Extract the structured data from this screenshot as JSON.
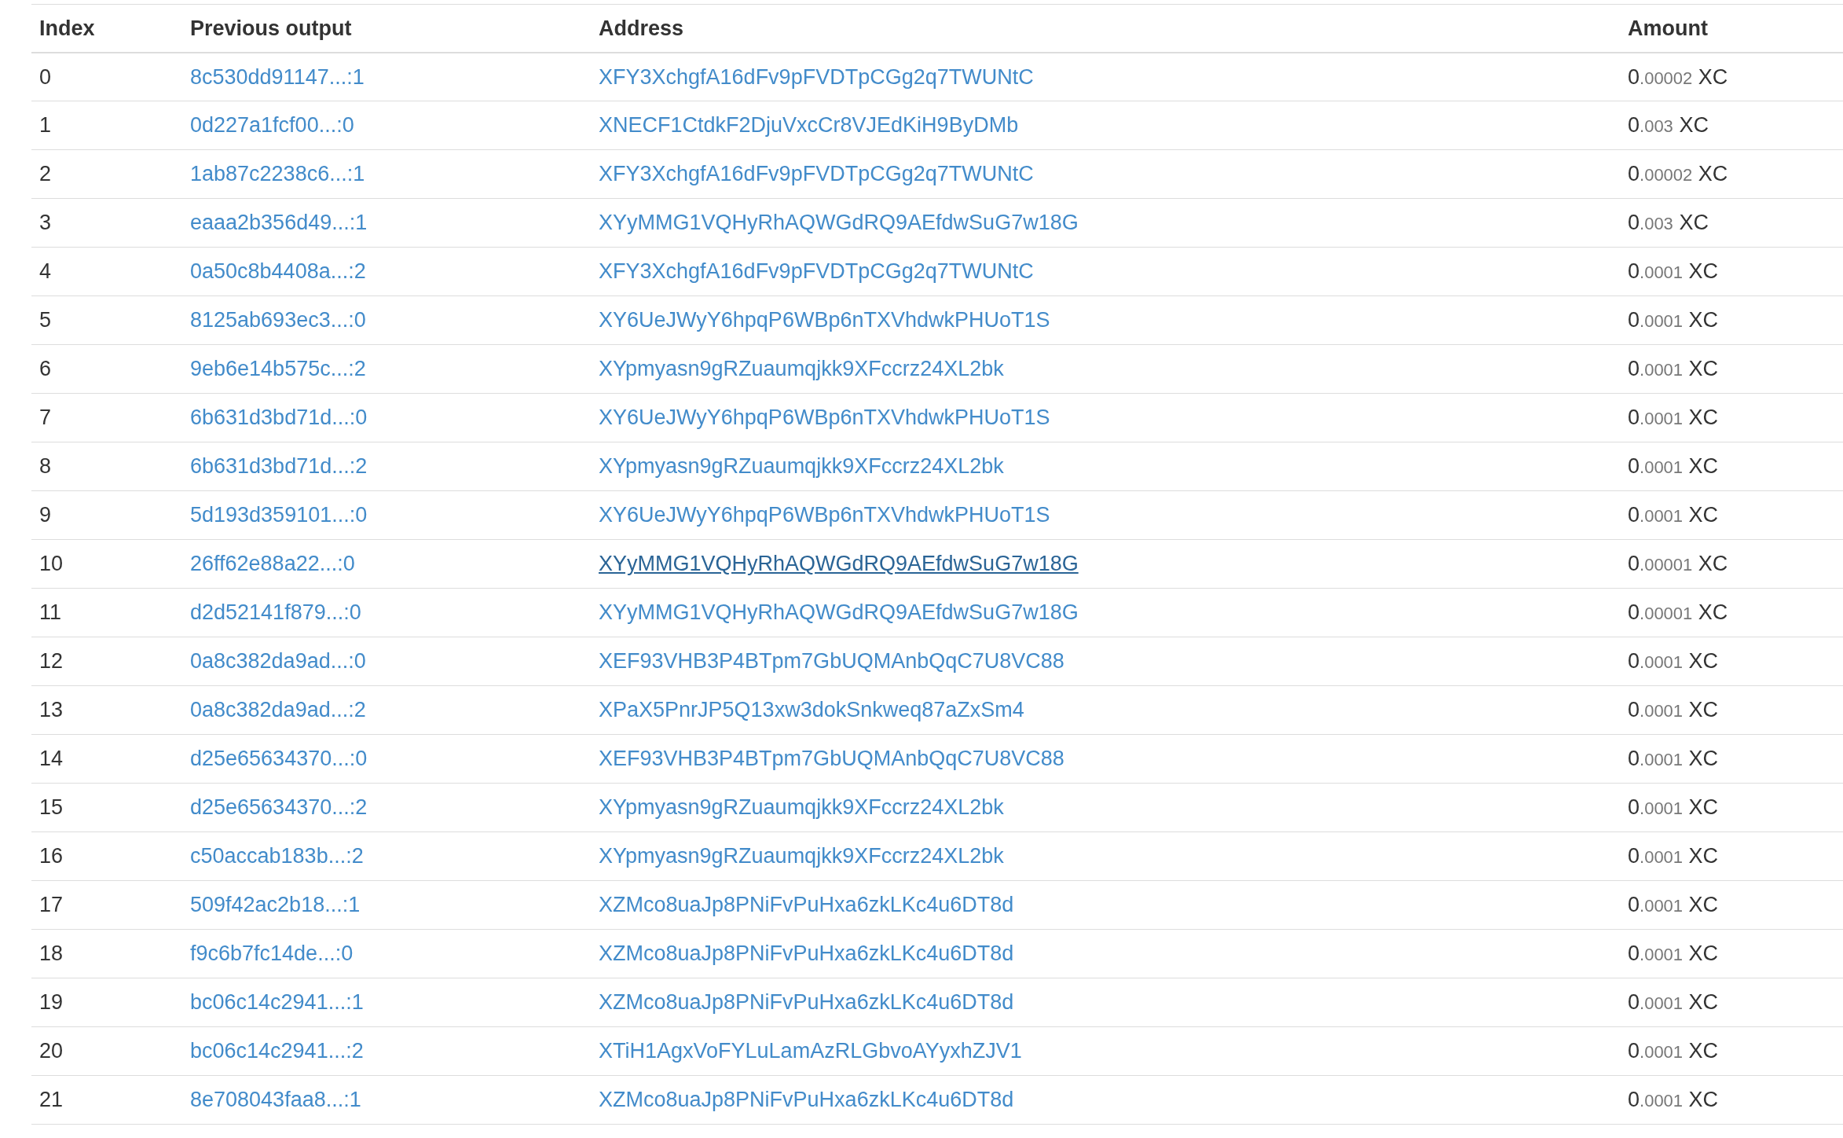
{
  "table": {
    "columns": [
      "Index",
      "Previous output",
      "Address",
      "Amount"
    ],
    "rows": [
      {
        "index": "0",
        "previous_output": "8c530dd91147...:1",
        "address": "XFY3XchgfA16dFv9pFVDTpCGg2q7TWUNtC",
        "address_hovered": false,
        "amount_whole": "0",
        "amount_fraction": ".00002",
        "unit": "XC"
      },
      {
        "index": "1",
        "previous_output": "0d227a1fcf00...:0",
        "address": "XNECF1CtdkF2DjuVxcCr8VJEdKiH9ByDMb",
        "address_hovered": false,
        "amount_whole": "0",
        "amount_fraction": ".003",
        "unit": "XC"
      },
      {
        "index": "2",
        "previous_output": "1ab87c2238c6...:1",
        "address": "XFY3XchgfA16dFv9pFVDTpCGg2q7TWUNtC",
        "address_hovered": false,
        "amount_whole": "0",
        "amount_fraction": ".00002",
        "unit": "XC"
      },
      {
        "index": "3",
        "previous_output": "eaaa2b356d49...:1",
        "address": "XYyMMG1VQHyRhAQWGdRQ9AEfdwSuG7w18G",
        "address_hovered": false,
        "amount_whole": "0",
        "amount_fraction": ".003",
        "unit": "XC"
      },
      {
        "index": "4",
        "previous_output": "0a50c8b4408a...:2",
        "address": "XFY3XchgfA16dFv9pFVDTpCGg2q7TWUNtC",
        "address_hovered": false,
        "amount_whole": "0",
        "amount_fraction": ".0001",
        "unit": "XC"
      },
      {
        "index": "5",
        "previous_output": "8125ab693ec3...:0",
        "address": "XY6UeJWyY6hpqP6WBp6nTXVhdwkPHUoT1S",
        "address_hovered": false,
        "amount_whole": "0",
        "amount_fraction": ".0001",
        "unit": "XC"
      },
      {
        "index": "6",
        "previous_output": "9eb6e14b575c...:2",
        "address": "XYpmyasn9gRZuaumqjkk9XFccrz24XL2bk",
        "address_hovered": false,
        "amount_whole": "0",
        "amount_fraction": ".0001",
        "unit": "XC"
      },
      {
        "index": "7",
        "previous_output": "6b631d3bd71d...:0",
        "address": "XY6UeJWyY6hpqP6WBp6nTXVhdwkPHUoT1S",
        "address_hovered": false,
        "amount_whole": "0",
        "amount_fraction": ".0001",
        "unit": "XC"
      },
      {
        "index": "8",
        "previous_output": "6b631d3bd71d...:2",
        "address": "XYpmyasn9gRZuaumqjkk9XFccrz24XL2bk",
        "address_hovered": false,
        "amount_whole": "0",
        "amount_fraction": ".0001",
        "unit": "XC"
      },
      {
        "index": "9",
        "previous_output": "5d193d359101...:0",
        "address": "XY6UeJWyY6hpqP6WBp6nTXVhdwkPHUoT1S",
        "address_hovered": false,
        "amount_whole": "0",
        "amount_fraction": ".0001",
        "unit": "XC"
      },
      {
        "index": "10",
        "previous_output": "26ff62e88a22...:0",
        "address": "XYyMMG1VQHyRhAQWGdRQ9AEfdwSuG7w18G",
        "address_hovered": true,
        "amount_whole": "0",
        "amount_fraction": ".00001",
        "unit": "XC"
      },
      {
        "index": "11",
        "previous_output": "d2d52141f879...:0",
        "address": "XYyMMG1VQHyRhAQWGdRQ9AEfdwSuG7w18G",
        "address_hovered": false,
        "amount_whole": "0",
        "amount_fraction": ".00001",
        "unit": "XC"
      },
      {
        "index": "12",
        "previous_output": "0a8c382da9ad...:0",
        "address": "XEF93VHB3P4BTpm7GbUQMAnbQqC7U8VC88",
        "address_hovered": false,
        "amount_whole": "0",
        "amount_fraction": ".0001",
        "unit": "XC"
      },
      {
        "index": "13",
        "previous_output": "0a8c382da9ad...:2",
        "address": "XPaX5PnrJP5Q13xw3dokSnkweq87aZxSm4",
        "address_hovered": false,
        "amount_whole": "0",
        "amount_fraction": ".0001",
        "unit": "XC"
      },
      {
        "index": "14",
        "previous_output": "d25e65634370...:0",
        "address": "XEF93VHB3P4BTpm7GbUQMAnbQqC7U8VC88",
        "address_hovered": false,
        "amount_whole": "0",
        "amount_fraction": ".0001",
        "unit": "XC"
      },
      {
        "index": "15",
        "previous_output": "d25e65634370...:2",
        "address": "XYpmyasn9gRZuaumqjkk9XFccrz24XL2bk",
        "address_hovered": false,
        "amount_whole": "0",
        "amount_fraction": ".0001",
        "unit": "XC"
      },
      {
        "index": "16",
        "previous_output": "c50accab183b...:2",
        "address": "XYpmyasn9gRZuaumqjkk9XFccrz24XL2bk",
        "address_hovered": false,
        "amount_whole": "0",
        "amount_fraction": ".0001",
        "unit": "XC"
      },
      {
        "index": "17",
        "previous_output": "509f42ac2b18...:1",
        "address": "XZMco8uaJp8PNiFvPuHxa6zkLKc4u6DT8d",
        "address_hovered": false,
        "amount_whole": "0",
        "amount_fraction": ".0001",
        "unit": "XC"
      },
      {
        "index": "18",
        "previous_output": "f9c6b7fc14de...:0",
        "address": "XZMco8uaJp8PNiFvPuHxa6zkLKc4u6DT8d",
        "address_hovered": false,
        "amount_whole": "0",
        "amount_fraction": ".0001",
        "unit": "XC"
      },
      {
        "index": "19",
        "previous_output": "bc06c14c2941...:1",
        "address": "XZMco8uaJp8PNiFvPuHxa6zkLKc4u6DT8d",
        "address_hovered": false,
        "amount_whole": "0",
        "amount_fraction": ".0001",
        "unit": "XC"
      },
      {
        "index": "20",
        "previous_output": "bc06c14c2941...:2",
        "address": "XTiH1AgxVoFYLuLamAzRLGbvoAYyxhZJV1",
        "address_hovered": false,
        "amount_whole": "0",
        "amount_fraction": ".0001",
        "unit": "XC"
      },
      {
        "index": "21",
        "previous_output": "8e708043faa8...:1",
        "address": "XZMco8uaJp8PNiFvPuHxa6zkLKc4u6DT8d",
        "address_hovered": false,
        "amount_whole": "0",
        "amount_fraction": ".0001",
        "unit": "XC"
      }
    ]
  }
}
